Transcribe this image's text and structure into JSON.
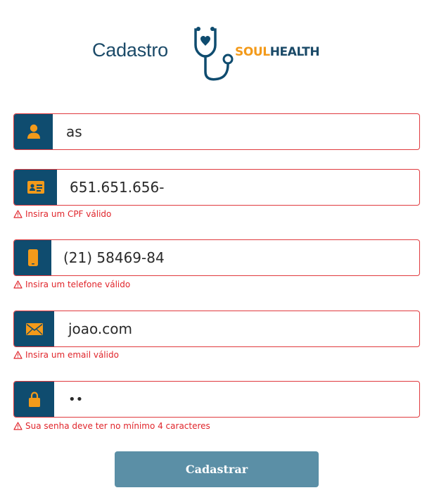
{
  "header": {
    "title": "Cadastro",
    "brand_soul": "SOUL",
    "brand_health": "HEALTH"
  },
  "form": {
    "name": {
      "value": "as",
      "icon": "user-icon"
    },
    "cpf": {
      "value": "651.651.656-",
      "icon": "id-card-icon",
      "error": "Insira um CPF válido"
    },
    "phone": {
      "value": "(21) 58469-84",
      "icon": "phone-icon",
      "error": "Insira um telefone válido"
    },
    "email": {
      "value": "joao.com",
      "icon": "envelope-icon",
      "error": "Insira um email válido"
    },
    "password": {
      "value": "••",
      "icon": "lock-icon",
      "error": "Sua senha deve ter no mínimo 4 caracteres"
    },
    "submit_label": "Cadastrar"
  },
  "colors": {
    "primary": "#0f4c6f",
    "accent": "#f39a1a",
    "error": "#e0252b",
    "button": "#5b8fa6"
  }
}
